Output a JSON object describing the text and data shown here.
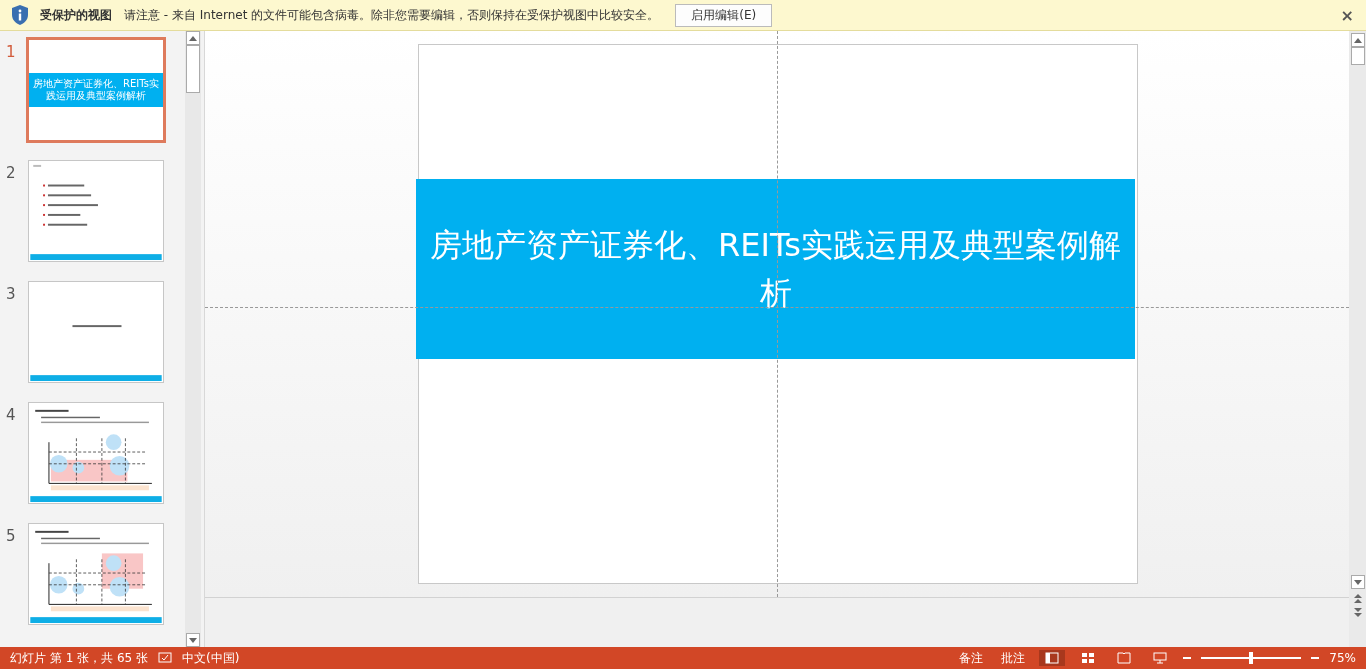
{
  "protected_bar": {
    "title": "受保护的视图",
    "message": "请注意 - 来自 Internet 的文件可能包含病毒。除非您需要编辑，否则保持在受保护视图中比较安全。",
    "button": "启用编辑(E)",
    "close": "×"
  },
  "thumbnails": [
    {
      "number": "1",
      "selected": true,
      "kind": "title",
      "title": "房地产资产证券化、REITs实践运用及典型案例解析"
    },
    {
      "number": "2",
      "selected": false,
      "kind": "list"
    },
    {
      "number": "3",
      "selected": false,
      "kind": "section"
    },
    {
      "number": "4",
      "selected": false,
      "kind": "chart"
    },
    {
      "number": "5",
      "selected": false,
      "kind": "chart"
    }
  ],
  "slide": {
    "title": "房地产资产证券化、REITs实践运用及典型案例解析"
  },
  "status_bar": {
    "slide_info": "幻灯片 第 1 张，共 65 张",
    "language": "中文(中国)",
    "notes": "备注",
    "comments": "批注",
    "zoom": "75%",
    "zoom_slider": {
      "level": 0.5
    }
  }
}
